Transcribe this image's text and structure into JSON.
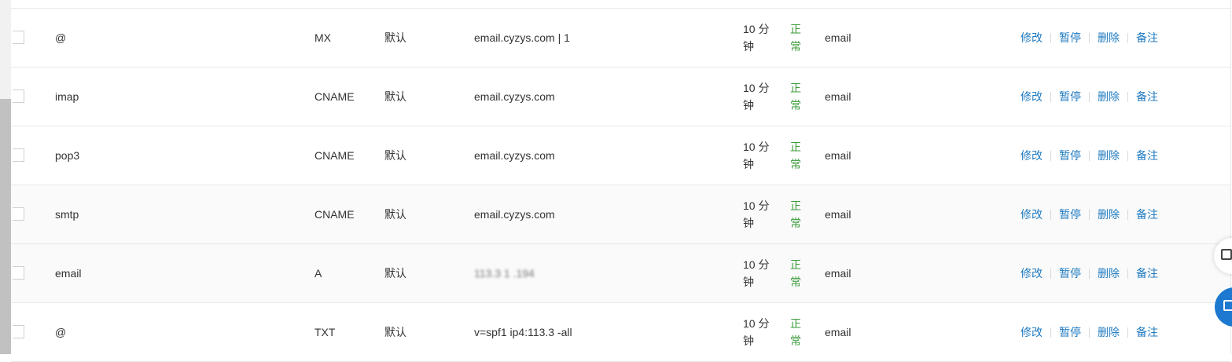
{
  "records": [
    {
      "host": "@",
      "type": "MX",
      "line": "默认",
      "value": "email.cyzys.com | 1",
      "value_blurred": false,
      "ttl_1": "10 分",
      "ttl_2": "钟",
      "status_1": "正",
      "status_2": "常",
      "remark": "email"
    },
    {
      "host": "imap",
      "type": "CNAME",
      "line": "默认",
      "value": "email.cyzys.com",
      "value_blurred": false,
      "ttl_1": "10 分",
      "ttl_2": "钟",
      "status_1": "正",
      "status_2": "常",
      "remark": "email"
    },
    {
      "host": "pop3",
      "type": "CNAME",
      "line": "默认",
      "value": "email.cyzys.com",
      "value_blurred": false,
      "ttl_1": "10 分",
      "ttl_2": "钟",
      "status_1": "正",
      "status_2": "常",
      "remark": "email"
    },
    {
      "host": "smtp",
      "type": "CNAME",
      "line": "默认",
      "value": "email.cyzys.com",
      "value_blurred": false,
      "ttl_1": "10 分",
      "ttl_2": "钟",
      "status_1": "正",
      "status_2": "常",
      "remark": "email"
    },
    {
      "host": "email",
      "type": "A",
      "line": "默认",
      "value": "113.3  1  .194",
      "value_blurred": true,
      "ttl_1": "10 分",
      "ttl_2": "钟",
      "status_1": "正",
      "status_2": "常",
      "remark": "email"
    },
    {
      "host": "@",
      "type": "TXT",
      "line": "默认",
      "value": "v=spf1 ip4:113.3           -all",
      "value_blurred": true,
      "ttl_1": "10 分",
      "ttl_2": "钟",
      "status_1": "正",
      "status_2": "常",
      "remark": "email"
    }
  ],
  "actions": {
    "edit": "修改",
    "pause": "暂停",
    "delete": "删除",
    "note": "备注"
  },
  "colors": {
    "link": "#1f7bc1",
    "status_ok": "#3a9b3a",
    "float_button": "#1d78d0"
  },
  "icons": {
    "feedback": "feedback-icon",
    "apps": "grid-icon"
  }
}
